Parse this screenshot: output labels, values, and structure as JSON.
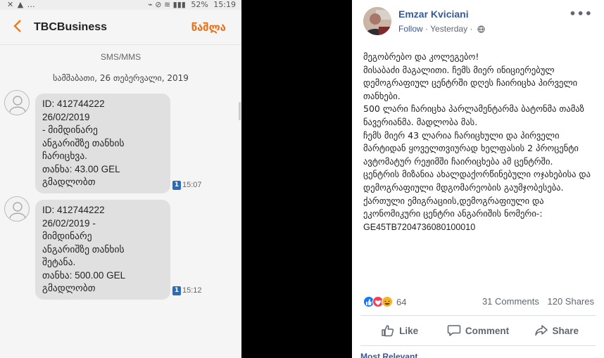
{
  "phone": {
    "status_bar": {
      "left_icons": "✕ ▲ …",
      "right_icons": "⌁ ⊘ ≋ ▮▮▮",
      "battery": "52%",
      "clock": "15:19"
    },
    "app_bar": {
      "contact_name": "TBCBusiness",
      "delete_label": "წაშლა"
    },
    "channel_label": "SMS/MMS",
    "date_header": "სამშაბათი, 26 თებერვალი, 2019",
    "messages": [
      {
        "text": "ID: 412744222\n26/02/2019\n-  მიმდინარე\nანგარიშზე თანხის\nჩარიცხვა.\nთანხა: 43.00 GEL\nგმადლობთ",
        "sim": "1",
        "time": "15:07"
      },
      {
        "text": "ID: 412744222\n26/02/2019 -\nმიმდინარე\nანგარიშზე თანხის\nშეტანა.\nთანხა: 500.00 GEL\nგმადლობთ",
        "sim": "1",
        "time": "15:12"
      }
    ]
  },
  "post": {
    "author": "Emzar Kviciani",
    "follow_label": "Follow",
    "timestamp": "Yesterday",
    "more_label": "•••",
    "paragraphs": [
      "მეგობრებო და კოლეგებო!",
      "მისაბაძი მაგალითი. ჩემს მიერ ინიციერებულ დემოგრაფიულ ცენტრში დღეს ჩაირიცხა პირველი თანხები.",
      "500 ლარი ჩარიცხა პარლამენტარმა ბატონმა თამაზ ნავერიანმა. მადლობა მას.",
      "ჩემს მიერ 43 ლარია ჩარიცხული და პირველი მარტიდან ყოველთვიურად ხელფასის 2 პროცენტი ავტომატურ რეჟიმში ჩაირიცხება ამ ცენტრში.",
      "ცენტრის მიზანია ახალდაქორწინებული ოჯახებისა და დემოგრაფიული მდგომარეობის გაუმჯობესება.",
      "ქართული ემიგრაციის,დემოგრაფიული და ეკონომიკური ცენტრი ანგარიშის ნომერი-:"
    ],
    "iban": "GE45TB7204736080100010",
    "reaction_count": "64",
    "comments": "31 Comments",
    "shares": "120 Shares",
    "actions": {
      "like": "Like",
      "comment": "Comment",
      "share": "Share"
    },
    "most_relevant": "Most Relevant"
  },
  "colors": {
    "accent_orange": "#e8721a",
    "fb_blue": "#385898",
    "bubble_bg": "#e0e0e0",
    "sim_badge": "#2c6bb5"
  }
}
